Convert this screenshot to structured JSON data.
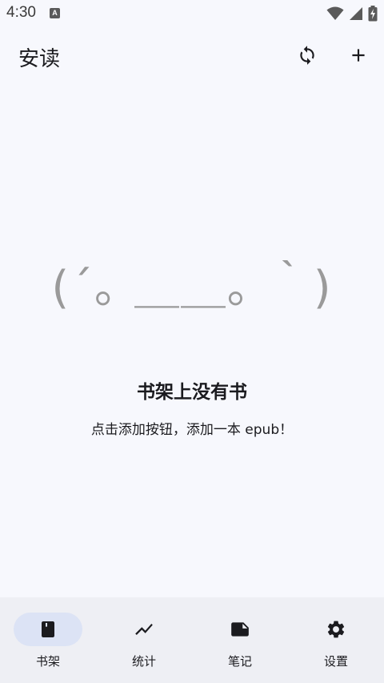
{
  "status_bar": {
    "time": "4:30",
    "notification_letter": "A",
    "icons": [
      "wifi-icon",
      "cell-signal-icon",
      "battery-charging-icon"
    ]
  },
  "app_bar": {
    "title": "安读",
    "actions": [
      "sync-icon",
      "add-icon"
    ]
  },
  "empty_state": {
    "kaomoji": "(´｡ ＿＿｡ ｀)",
    "title": "书架上没有书",
    "description": "点击添加按钮，添加一本 epub！"
  },
  "bottom_nav": {
    "items": [
      {
        "label": "书架",
        "icon": "book-icon",
        "active": true
      },
      {
        "label": "统计",
        "icon": "trend-icon",
        "active": false
      },
      {
        "label": "笔记",
        "icon": "note-icon",
        "active": false
      },
      {
        "label": "设置",
        "icon": "gear-icon",
        "active": false
      }
    ]
  },
  "colors": {
    "background": "#f7f8fd",
    "nav_background": "#eeeff4",
    "active_pill": "#dce3f5",
    "text": "#1b1b1f",
    "kaomoji": "#9a9a9a"
  }
}
